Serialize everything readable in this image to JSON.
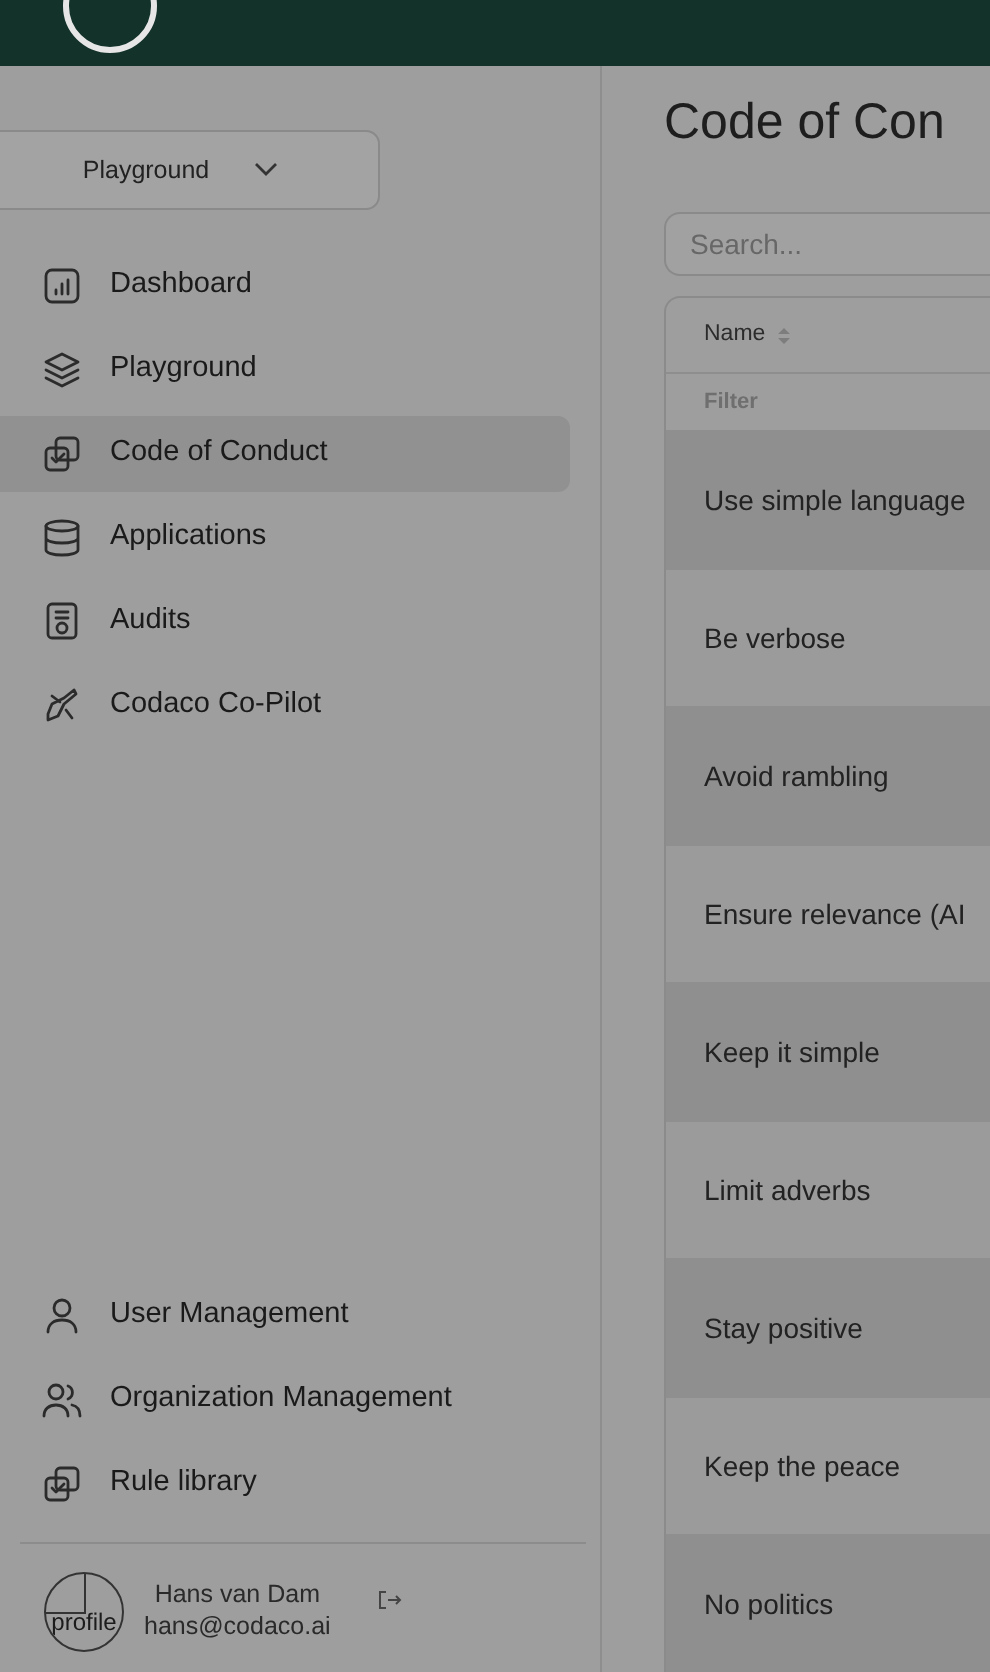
{
  "workspace_select": {
    "value": "Playground"
  },
  "nav": [
    {
      "label": "Dashboard",
      "selected": false
    },
    {
      "label": "Playground",
      "selected": false
    },
    {
      "label": "Code of Conduct",
      "selected": true
    },
    {
      "label": "Applications",
      "selected": false
    },
    {
      "label": "Audits",
      "selected": false
    },
    {
      "label": "Codaco Co-Pilot",
      "selected": false
    }
  ],
  "admin_nav": [
    {
      "label": "User Management",
      "selected": false
    },
    {
      "label": "Organization Management",
      "selected": false
    },
    {
      "label": "Rule library",
      "selected": false
    }
  ],
  "user": {
    "avatar_alt": "profile",
    "name": "Hans van Dam",
    "email": "hans@codaco.ai"
  },
  "page_title": "Code of Con",
  "search": {
    "placeholder": "Search..."
  },
  "table": {
    "columns": [
      {
        "label": "Name",
        "filter_placeholder": "Filter"
      }
    ],
    "rows": [
      "Use simple language",
      "Be verbose",
      "Avoid rambling",
      "Ensure relevance (AI",
      "Keep it simple",
      "Limit adverbs",
      "Stay positive",
      "Keep the peace",
      "No politics"
    ]
  }
}
